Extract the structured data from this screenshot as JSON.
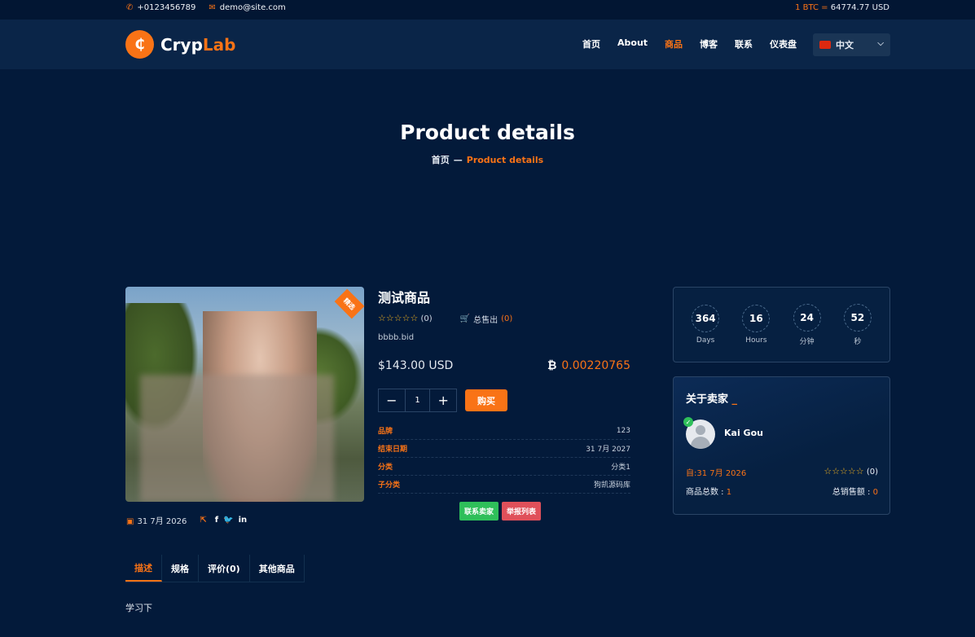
{
  "topbar": {
    "phone": "+0123456789",
    "email": "demo@site.com",
    "btc_label": "1 BTC =",
    "btc_value": "64774.77 USD"
  },
  "brand": {
    "part1": "Cryp",
    "part2": "Lab",
    "logo_glyph": "₵"
  },
  "nav": {
    "items": [
      "首页",
      "About",
      "商品",
      "博客",
      "联系",
      "仪表盘"
    ],
    "active_index": 2,
    "language": "中文"
  },
  "hero": {
    "title": "Product details",
    "breadcrumb_home": "首页",
    "breadcrumb_sep": "—",
    "breadcrumb_current": "Product details"
  },
  "product": {
    "badge": "精选",
    "title": "测试商品",
    "rating_count": "(0)",
    "sold_label": "总售出",
    "sold_count": "(0)",
    "bid_text": "bbbb.bid",
    "price_usd": "$143.00 USD",
    "price_btc": "0.00220765",
    "quantity": "1",
    "buy_label": "购买",
    "specs": [
      {
        "key": "品牌",
        "value": "123"
      },
      {
        "key": "结束日期",
        "value": "31 7月 2027"
      },
      {
        "key": "分类",
        "value": "分类1"
      },
      {
        "key": "子分类",
        "value": "狗凯源码库"
      }
    ],
    "date": "31 7月 2026",
    "contact_label": "联系卖家",
    "report_label": "举报列表"
  },
  "countdown": [
    {
      "value": "364",
      "label": "Days"
    },
    {
      "value": "16",
      "label": "Hours"
    },
    {
      "value": "24",
      "label": "分钟"
    },
    {
      "value": "52",
      "label": "秒"
    }
  ],
  "seller": {
    "heading": "关于卖家",
    "name": "Kai Gou",
    "since_label": "自:",
    "since_value": "31 7月 2026",
    "rating_count": "(0)",
    "total_products_label": "商品总数 :",
    "total_products_value": "1",
    "total_sales_label": "总销售额 :",
    "total_sales_value": "0"
  },
  "tabs": [
    "描述",
    "规格",
    "评价(0)",
    "其他商品"
  ],
  "description": "学习下",
  "colors": {
    "accent": "#f97316",
    "background": "#031a3a",
    "success": "#2fbf5a",
    "danger": "#e0505a"
  }
}
